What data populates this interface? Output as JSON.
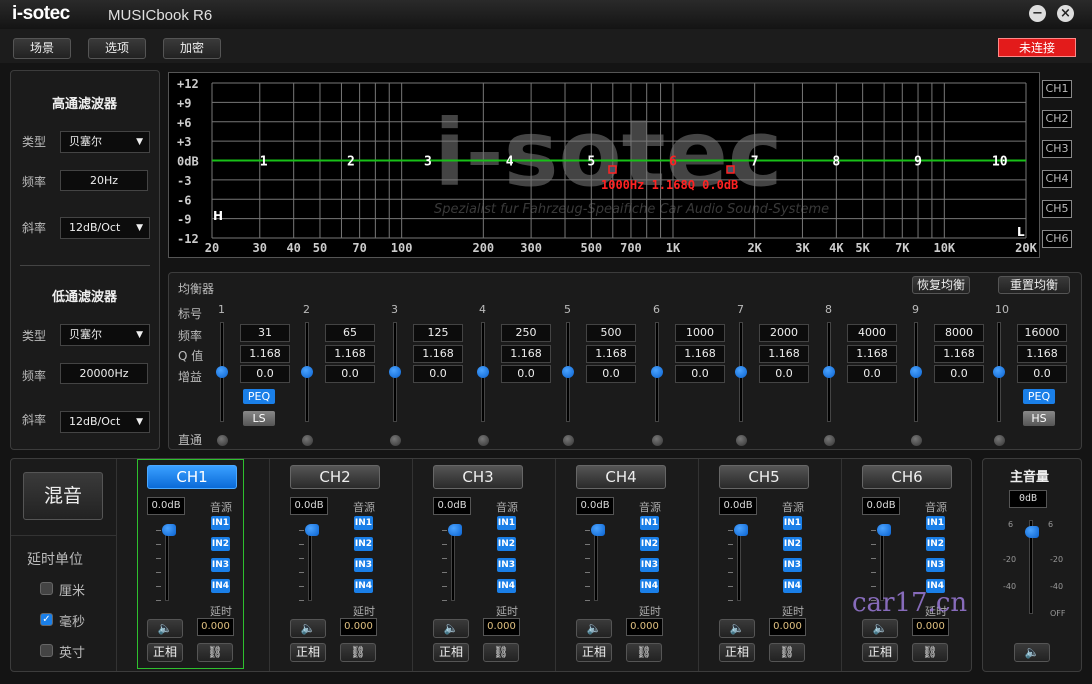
{
  "app": {
    "logo": "i-sotec",
    "title": "MUSICbook R6",
    "minimize": "−",
    "close": "×"
  },
  "toolbar": {
    "buttons": [
      "场景",
      "选项",
      "加密"
    ],
    "status": "未连接",
    "status_color": "#e31b1b"
  },
  "highpass": {
    "title": "高通滤波器",
    "type_label": "类型",
    "type": "贝塞尔",
    "freq_label": "频率",
    "freq": "20Hz",
    "slope_label": "斜率",
    "slope": "12dB/Oct"
  },
  "lowpass": {
    "title": "低通滤波器",
    "type_label": "类型",
    "type": "贝塞尔",
    "freq_label": "频率",
    "freq": "20000Hz",
    "slope_label": "斜率",
    "slope": "12dB/Oct"
  },
  "chart_data": {
    "type": "line",
    "y_ticks": [
      "+12",
      "+9",
      "+6",
      "+3",
      "0dB",
      "-3",
      "-6",
      "-9",
      "-12"
    ],
    "ylim": [
      -12,
      12
    ],
    "x_scale": "log",
    "xlim": [
      20,
      20000
    ],
    "x_ticks": [
      "20",
      "30",
      "40",
      "50",
      "70",
      "100",
      "200",
      "300",
      "500",
      "700",
      "1K",
      "2K",
      "3K",
      "4K",
      "5K",
      "7K",
      "10K",
      "20K"
    ],
    "series": [
      {
        "x": [
          20,
          20000
        ],
        "y": [
          0,
          0
        ],
        "color": "#18c018"
      }
    ],
    "band_markers": [
      "1",
      "2",
      "3",
      "4",
      "5",
      "6",
      "7",
      "8",
      "9",
      "10"
    ],
    "band_freqs": [
      31,
      65,
      125,
      250,
      500,
      1000,
      2000,
      4000,
      8000,
      16000
    ],
    "selected_band": 6,
    "hp_marker": "H",
    "lp_marker": "L",
    "readout": "1000Hz 1.168Q 0.0dB",
    "grid": true,
    "watermark": "i-sotec",
    "watermark_sub": "Spezialist fur Fahrzeug-Speaifiche Car Audio Sound-Systeme"
  },
  "chart_channels": [
    "CH1",
    "CH2",
    "CH3",
    "CH4",
    "CH5",
    "CH6"
  ],
  "eq": {
    "title": "均衡器",
    "restore": "恢复均衡",
    "reset": "重置均衡",
    "row_labels": {
      "index": "标号",
      "freq": "频率",
      "q": "Q 值",
      "gain": "增益",
      "bypass": "直通"
    },
    "bands": [
      {
        "n": "1",
        "freq": "31",
        "q": "1.168",
        "gain": "0.0",
        "peq": "PEQ",
        "type": "LS"
      },
      {
        "n": "2",
        "freq": "65",
        "q": "1.168",
        "gain": "0.0"
      },
      {
        "n": "3",
        "freq": "125",
        "q": "1.168",
        "gain": "0.0"
      },
      {
        "n": "4",
        "freq": "250",
        "q": "1.168",
        "gain": "0.0"
      },
      {
        "n": "5",
        "freq": "500",
        "q": "1.168",
        "gain": "0.0"
      },
      {
        "n": "6",
        "freq": "1000",
        "q": "1.168",
        "gain": "0.0"
      },
      {
        "n": "7",
        "freq": "2000",
        "q": "1.168",
        "gain": "0.0"
      },
      {
        "n": "8",
        "freq": "4000",
        "q": "1.168",
        "gain": "0.0"
      },
      {
        "n": "9",
        "freq": "8000",
        "q": "1.168",
        "gain": "0.0"
      },
      {
        "n": "10",
        "freq": "16000",
        "q": "1.168",
        "gain": "0.0",
        "peq": "PEQ",
        "type": "HS"
      }
    ]
  },
  "mix": {
    "button": "混音",
    "delay_unit": "延时单位",
    "units": [
      {
        "label": "厘米",
        "checked": false
      },
      {
        "label": "毫秒",
        "checked": true
      },
      {
        "label": "英寸",
        "checked": false
      }
    ]
  },
  "channels": [
    {
      "name": "CH1",
      "active": true,
      "level": "0.0dB",
      "delay": "0.000"
    },
    {
      "name": "CH2",
      "active": false,
      "level": "0.0dB",
      "delay": "0.000"
    },
    {
      "name": "CH3",
      "active": false,
      "level": "0.0dB",
      "delay": "0.000"
    },
    {
      "name": "CH4",
      "active": false,
      "level": "0.0dB",
      "delay": "0.000"
    },
    {
      "name": "CH5",
      "active": false,
      "level": "0.0dB",
      "delay": "0.000"
    },
    {
      "name": "CH6",
      "active": false,
      "level": "0.0dB",
      "delay": "0.000"
    }
  ],
  "channel_labels": {
    "source": "音源",
    "inputs": [
      "IN1",
      "IN2",
      "IN3",
      "IN4"
    ],
    "delay": "延时",
    "phase": "正相"
  },
  "master": {
    "title": "主音量",
    "value": "0dB",
    "scale": [
      "6",
      "-20",
      "-40",
      "OFF"
    ]
  },
  "watermark": "car17.cn"
}
